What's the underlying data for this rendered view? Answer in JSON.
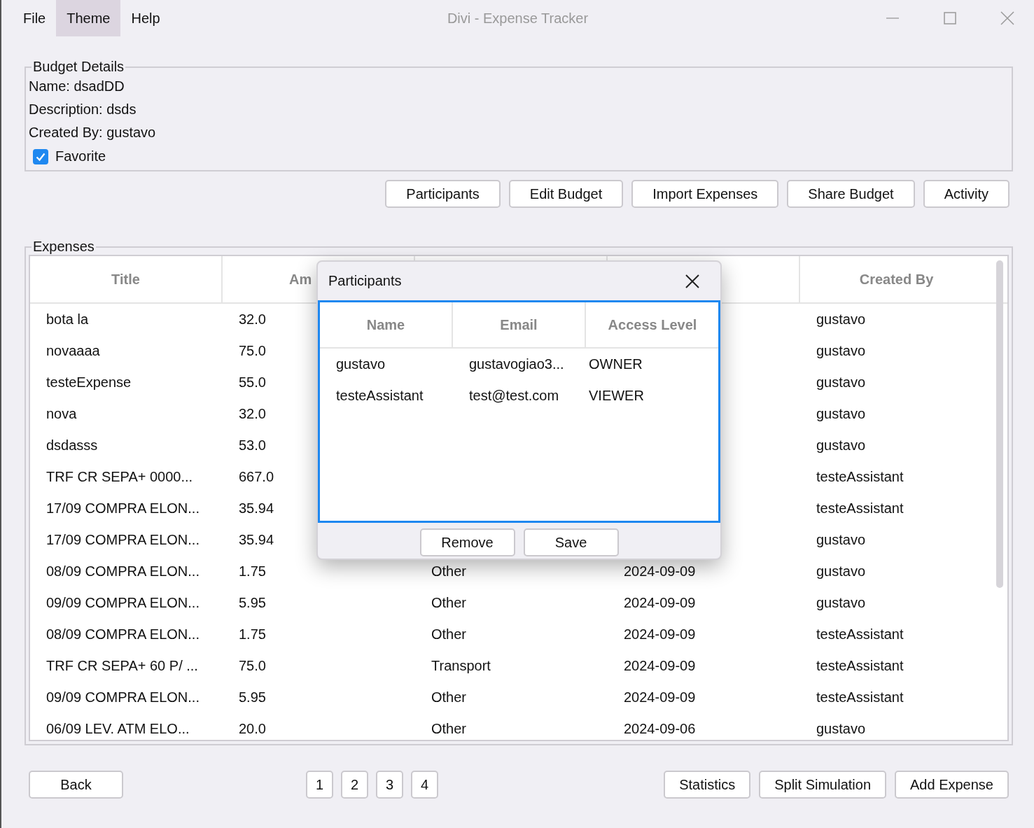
{
  "window": {
    "title": "Divi - Expense Tracker"
  },
  "menu": [
    {
      "label": "File",
      "selected": false
    },
    {
      "label": "Theme",
      "selected": true
    },
    {
      "label": "Help",
      "selected": false
    }
  ],
  "budget_details": {
    "legend": "Budget Details",
    "lines": [
      "Name: dsadDD",
      "Description: dsds",
      "Created By: gustavo"
    ],
    "favorite": {
      "label": "Favorite",
      "checked": true
    }
  },
  "actions": [
    "Participants",
    "Edit Budget",
    "Import Expenses",
    "Share Budget",
    "Activity"
  ],
  "expenses": {
    "legend": "Expenses",
    "header": {
      "title": "Title",
      "amount": "Am",
      "created_by": "Created By"
    },
    "rows": [
      {
        "title": "bota la",
        "amount": "32.0",
        "created_by": "gustavo"
      },
      {
        "title": "novaaaa",
        "amount": "75.0",
        "created_by": "gustavo"
      },
      {
        "title": "testeExpense",
        "amount": "55.0",
        "created_by": "gustavo"
      },
      {
        "title": "nova",
        "amount": "32.0",
        "created_by": "gustavo"
      },
      {
        "title": "dsdasss",
        "amount": "53.0",
        "created_by": "gustavo"
      },
      {
        "title": "TRF CR SEPA+ 0000...",
        "amount": "667.0",
        "created_by": "testeAssistant"
      },
      {
        "title": "17/09 COMPRA ELON...",
        "amount": "35.94",
        "created_by": "testeAssistant"
      },
      {
        "title": "17/09 COMPRA ELON...",
        "amount": "35.94",
        "created_by": "gustavo"
      },
      {
        "title": "08/09 COMPRA ELON...",
        "amount": "1.75",
        "category": "Other",
        "date": "2024-09-09",
        "created_by": "gustavo"
      },
      {
        "title": "09/09 COMPRA ELON...",
        "amount": "5.95",
        "category": "Other",
        "date": "2024-09-09",
        "created_by": "gustavo"
      },
      {
        "title": "08/09 COMPRA ELON...",
        "amount": "1.75",
        "category": "Other",
        "date": "2024-09-09",
        "created_by": "testeAssistant"
      },
      {
        "title": "TRF CR SEPA+ 60 P/ ...",
        "amount": "75.0",
        "category": "Transport",
        "date": "2024-09-09",
        "created_by": "testeAssistant"
      },
      {
        "title": "09/09 COMPRA ELON...",
        "amount": "5.95",
        "category": "Other",
        "date": "2024-09-09",
        "created_by": "testeAssistant"
      },
      {
        "title": "06/09 LEV. ATM ELO...",
        "amount": "20.0",
        "category": "Other",
        "date": "2024-09-06",
        "created_by": "gustavo"
      }
    ]
  },
  "footer": {
    "back": "Back",
    "pages": [
      "1",
      "2",
      "3",
      "4"
    ],
    "buttons": [
      "Statistics",
      "Split Simulation",
      "Add Expense"
    ]
  },
  "dialog": {
    "title": "Participants",
    "columns": [
      "Name",
      "Email",
      "Access Level"
    ],
    "rows": [
      {
        "name": "gustavo",
        "email": "gustavogiao3...",
        "access_level": "OWNER"
      },
      {
        "name": "testeAssistant",
        "email": "test@test.com",
        "access_level": "VIEWER"
      }
    ],
    "buttons": [
      "Remove",
      "Save"
    ]
  }
}
